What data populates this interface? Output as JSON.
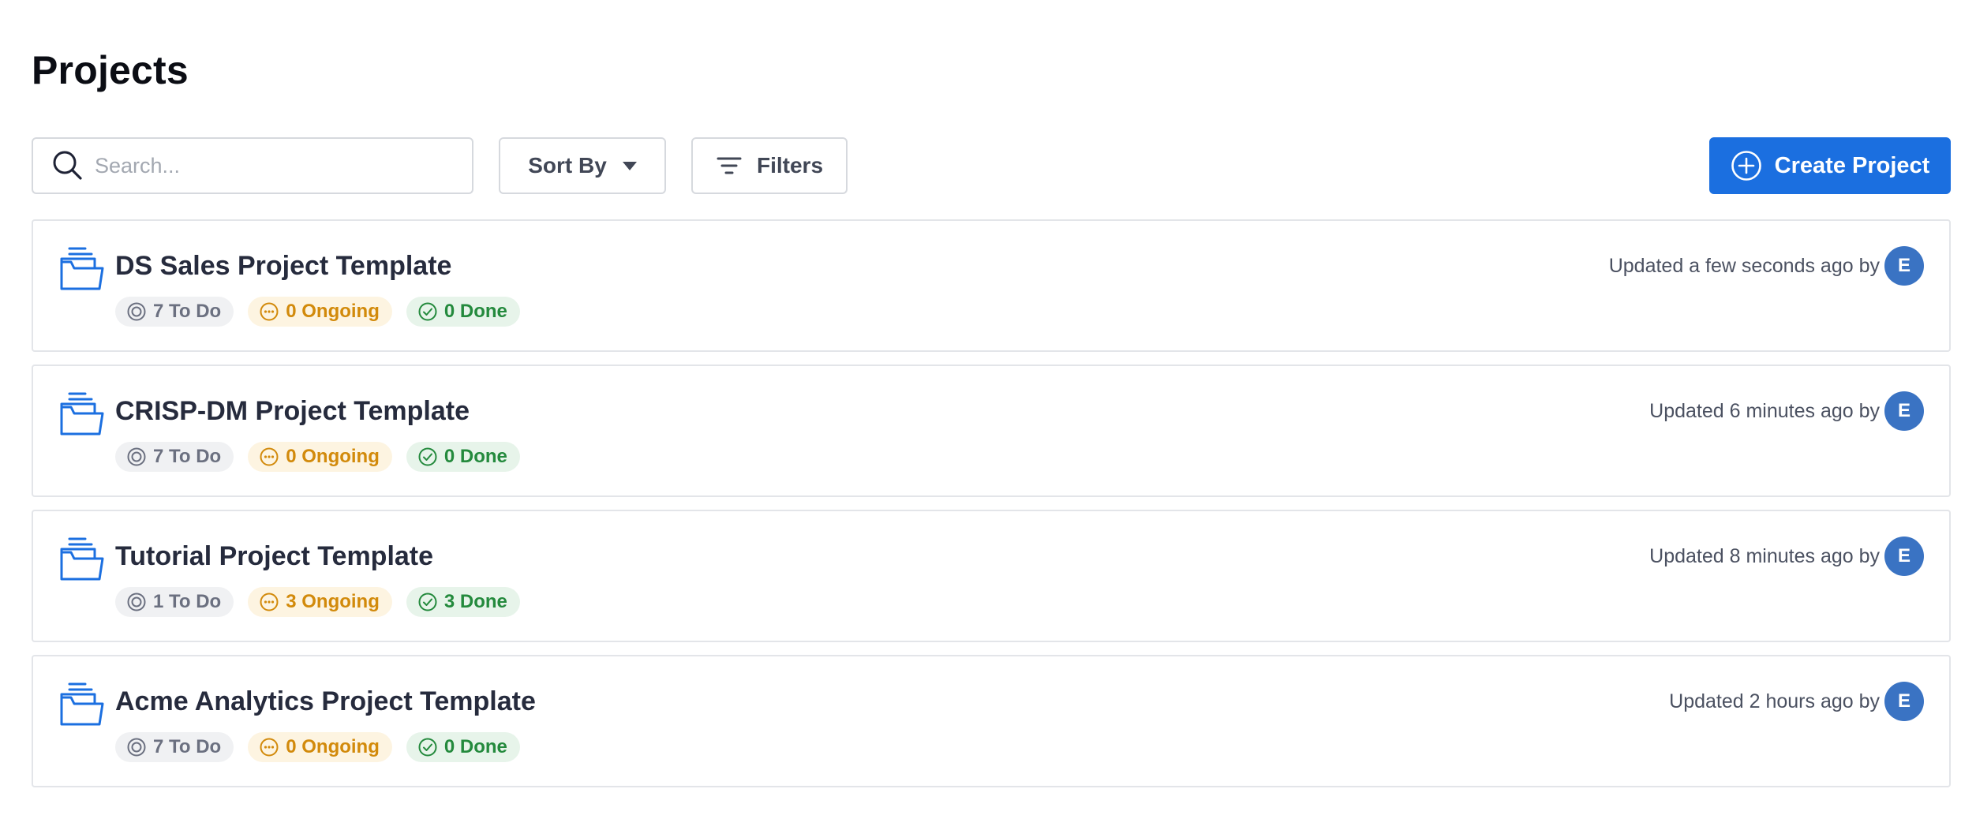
{
  "page": {
    "title": "Projects"
  },
  "toolbar": {
    "search_placeholder": "Search...",
    "sort_label": "Sort By",
    "filters_label": "Filters",
    "create_label": "Create Project"
  },
  "colors": {
    "primary": "#1b6fe0",
    "todo": "#6b7080",
    "ongoing": "#d28a0b",
    "done": "#248a3d",
    "avatar": "#3a73c3"
  },
  "icons": {
    "search": "search-icon",
    "sort": "caret-down-icon",
    "filters": "filter-icon",
    "create": "plus-circle-icon",
    "project": "folder-open-icon",
    "todo": "circle-dot-icon",
    "ongoing": "ellipsis-circle-icon",
    "done": "check-circle-icon"
  },
  "projects": [
    {
      "name": "DS Sales Project Template",
      "todo": "7 To Do",
      "ongoing": "0 Ongoing",
      "done": "0 Done",
      "updated": "Updated a few seconds ago by",
      "avatar": "E"
    },
    {
      "name": "CRISP-DM Project Template",
      "todo": "7 To Do",
      "ongoing": "0 Ongoing",
      "done": "0 Done",
      "updated": "Updated 6 minutes ago by",
      "avatar": "E"
    },
    {
      "name": "Tutorial Project Template",
      "todo": "1 To Do",
      "ongoing": "3 Ongoing",
      "done": "3 Done",
      "updated": "Updated 8 minutes ago by",
      "avatar": "E"
    },
    {
      "name": "Acme Analytics Project Template",
      "todo": "7 To Do",
      "ongoing": "0 Ongoing",
      "done": "0 Done",
      "updated": "Updated 2 hours ago by",
      "avatar": "E"
    }
  ]
}
